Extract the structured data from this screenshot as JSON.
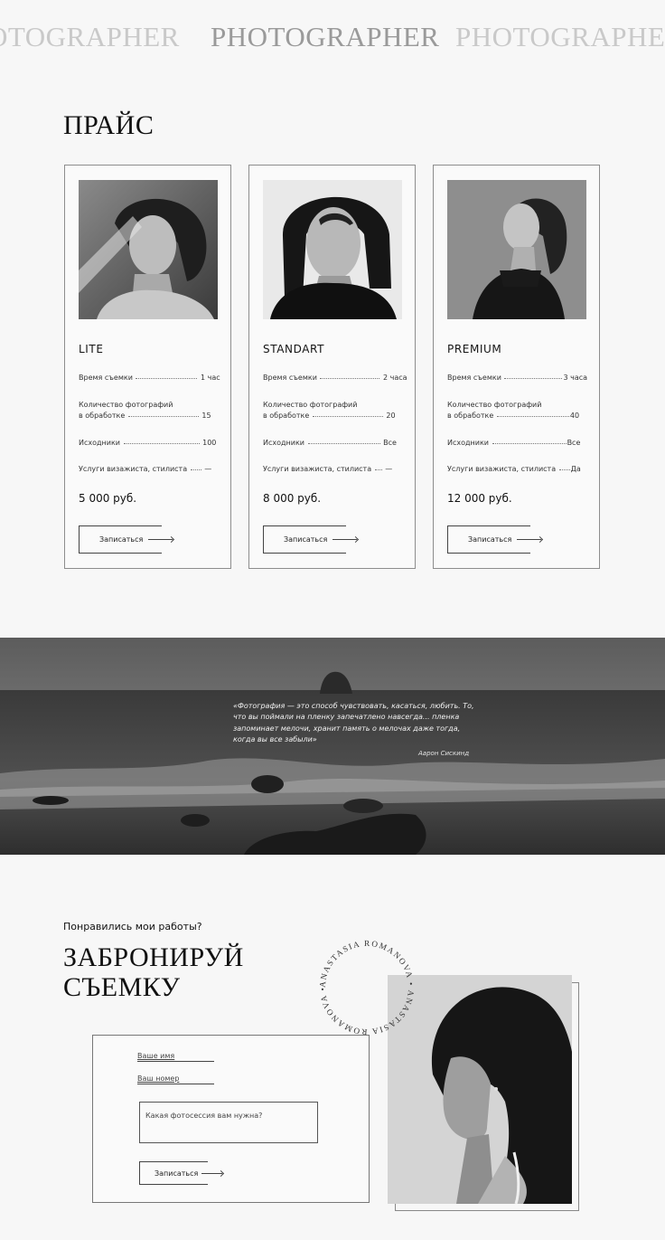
{
  "ticker": {
    "left": "OTOGRAPHER",
    "center": "PHOTOGRAPHER",
    "right": "PHOTOGRAPHE"
  },
  "price_section": {
    "title": "ПРАЙС",
    "cards": [
      {
        "tier": "LITE",
        "rows": [
          {
            "label": "Время съемки",
            "value": "1 час"
          },
          {
            "label": "Количество фотографий",
            "label2": "в обработке",
            "value": "15"
          },
          {
            "label": "Исходники",
            "value": "100"
          },
          {
            "label": "Услуги визажиста, стилиста",
            "value": "—"
          }
        ],
        "price": "5 000 руб.",
        "button": "Записаться"
      },
      {
        "tier": "STANDART",
        "rows": [
          {
            "label": "Время съемки",
            "value": "2 часа"
          },
          {
            "label": "Количество фотографий",
            "label2": "в обработке",
            "value": "20"
          },
          {
            "label": "Исходники",
            "value": "Все"
          },
          {
            "label": "Услуги визажиста, стилиста",
            "value": "—"
          }
        ],
        "price": "8 000 руб.",
        "button": "Записаться"
      },
      {
        "tier": "PREMIUM",
        "rows": [
          {
            "label": "Время съемки",
            "value": "3 часа"
          },
          {
            "label": "Количество фотографий",
            "label2": "в обработке",
            "value": "40"
          },
          {
            "label": "Исходники",
            "value": "Все"
          },
          {
            "label": "Услуги визажиста, стилиста",
            "value": "Да"
          }
        ],
        "price": "12 000 руб.",
        "button": "Записаться"
      }
    ]
  },
  "quote": {
    "text": "«Фотография — это способ чувствовать, касаться, любить. То, что вы поймали на пленку запечатлено навсегда... пленка запоминает мелочи, хранит память о мелочах даже тогда, когда вы все забыли»",
    "author": "Аарон Сискинд"
  },
  "booking": {
    "question": "Понравились мои работы?",
    "title_line1": "ЗАБРОНИРУЙ",
    "title_line2": "СЪЕМКУ",
    "stamp_text": "ANASTASIA ROMANOVA • ANASTASIA ROMANOVA •",
    "name_placeholder": "Ваше имя",
    "phone_placeholder": "Ваш номер",
    "message_placeholder": "Какая фотосессия вам нужна?",
    "submit": "Записаться"
  },
  "colors": {
    "background": "#f7f7f7",
    "text": "#1c1c1c",
    "border": "#8d8d8d"
  },
  "icons": {
    "button_arrow": "arrow-right-icon"
  }
}
